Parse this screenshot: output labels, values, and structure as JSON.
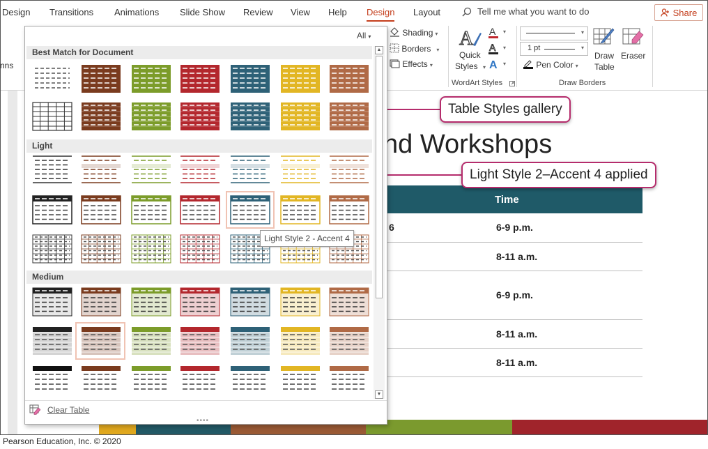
{
  "ribbon_tabs": [
    {
      "label": "Design",
      "active": false
    },
    {
      "label": "Transitions",
      "active": false
    },
    {
      "label": "Animations",
      "active": false
    },
    {
      "label": "Slide Show",
      "active": false
    },
    {
      "label": "Review",
      "active": false
    },
    {
      "label": "View",
      "active": false
    },
    {
      "label": "Help",
      "active": false
    },
    {
      "label": "Design",
      "active": true
    },
    {
      "label": "Layout",
      "active": false
    }
  ],
  "tell_me": "Tell me what you want to do",
  "share": "Share",
  "left_fragment": "nns",
  "ribbon": {
    "shading": "Shading",
    "borders": "Borders",
    "effects": "Effects",
    "quick_styles_1": "Quick",
    "quick_styles_2": "Styles",
    "wordart_group": "WordArt Styles",
    "pen_weight": "1 pt",
    "pen_color": "Pen Color",
    "draw_table_1": "Draw",
    "draw_table_2": "Table",
    "eraser": "Eraser",
    "draw_borders_group": "Draw Borders"
  },
  "gallery": {
    "filter": "All",
    "sections": [
      "Best Match for Document",
      "Light",
      "Medium"
    ],
    "tooltip": "Light Style 2 - Accent 4",
    "clear_table": "Clear Table",
    "accent_colors": {
      "plain": "#555555",
      "accent1": "#7a3b1e",
      "accent2": "#7c9c2a",
      "accent3": "#b3272d",
      "accent4": "#2e6177",
      "accent5": "#e2b624",
      "accent6": "#b06a46"
    }
  },
  "callouts": {
    "gallery": "Table Styles gallery",
    "applied": "Light Style 2–Accent 4 applied"
  },
  "slide": {
    "title": "nd Workshops",
    "header_time": "Time",
    "row_fragment": "6",
    "times": [
      "6-9 p.m.",
      "8-11 a.m.",
      "6-9 p.m.",
      "8-11 a.m.",
      "8-11 a.m."
    ],
    "strip_colors": [
      "#e0a81e",
      "#235966",
      "#9a5a35",
      "#7b9a2e",
      "#e0a81e",
      "#a0242b"
    ]
  },
  "copyright": "Pearson Education, Inc. © 2020"
}
